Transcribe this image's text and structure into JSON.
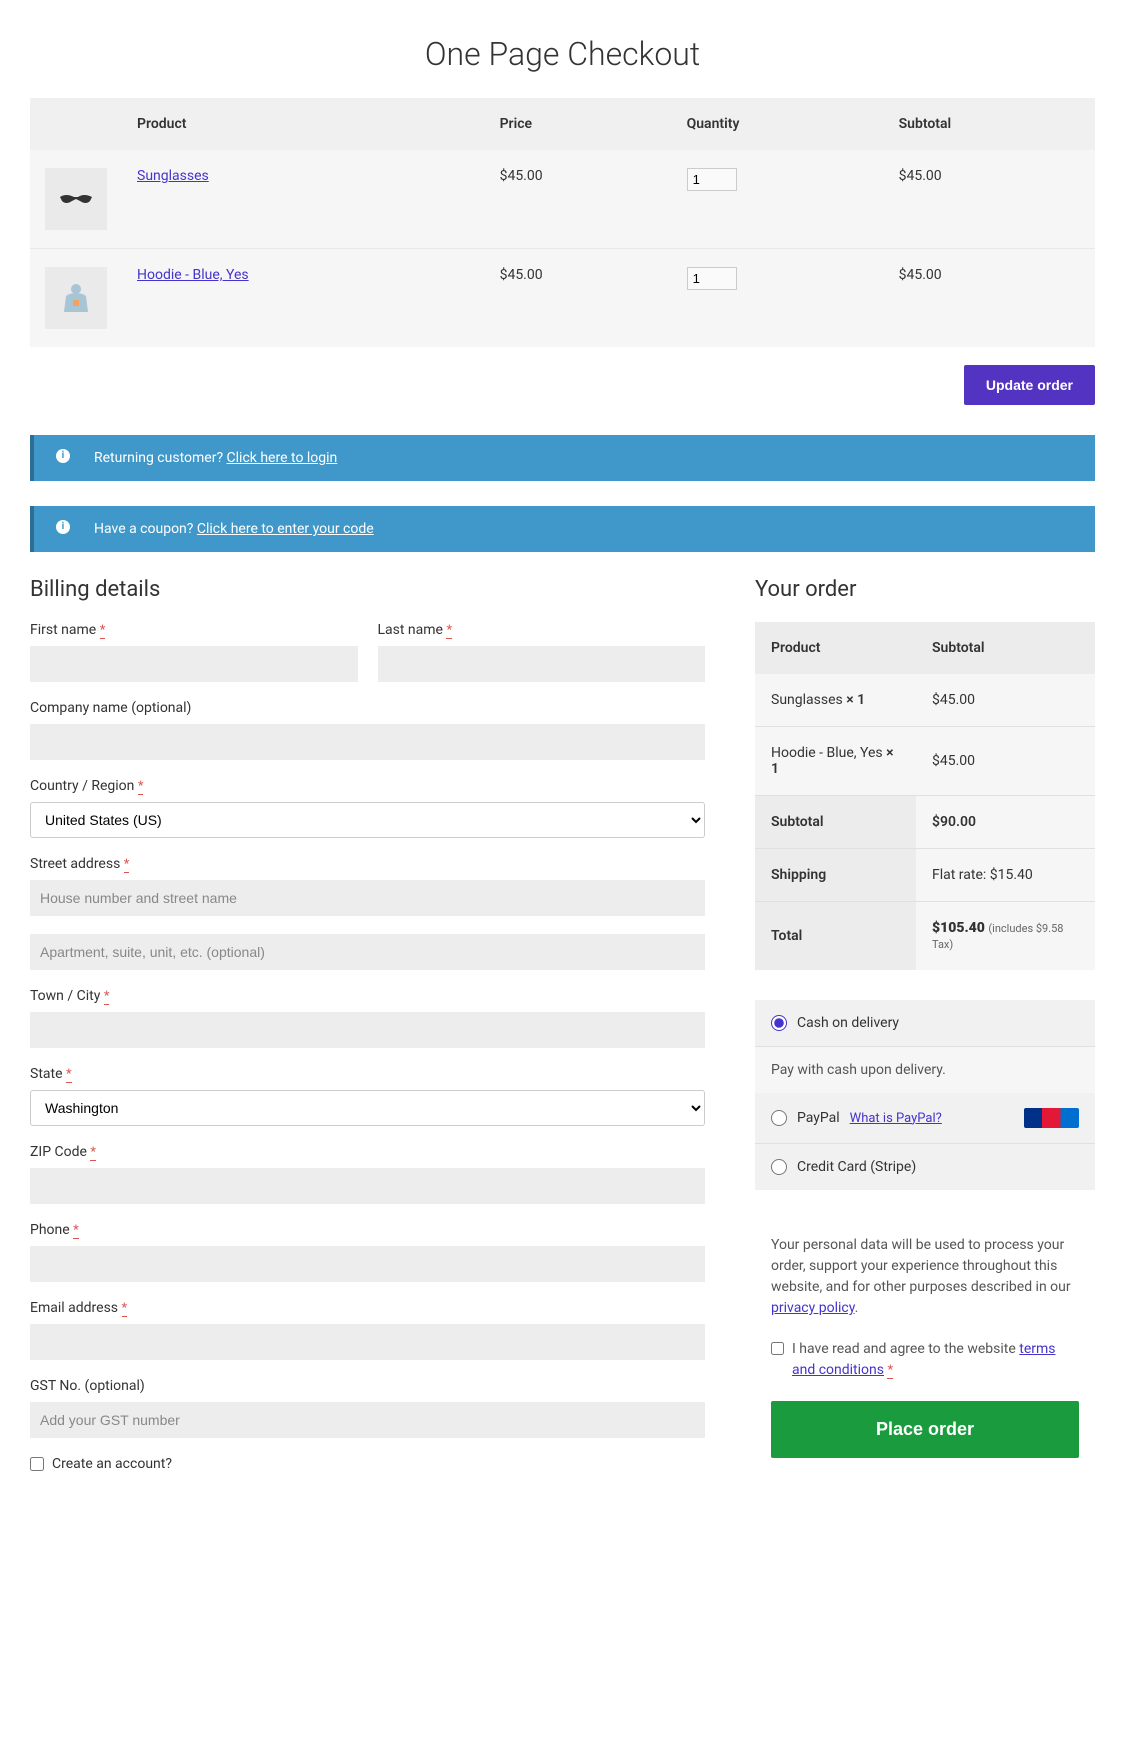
{
  "page_title": "One Page Checkout",
  "product_table": {
    "headers": {
      "product": "Product",
      "price": "Price",
      "quantity": "Quantity",
      "subtotal": "Subtotal"
    },
    "rows": [
      {
        "name": "Sunglasses",
        "price": "$45.00",
        "qty": "1",
        "subtotal": "$45.00",
        "thumb": "sunglasses"
      },
      {
        "name": "Hoodie - Blue, Yes",
        "price": "$45.00",
        "qty": "1",
        "subtotal": "$45.00",
        "thumb": "hoodie"
      }
    ]
  },
  "update_btn": "Update order",
  "notice_login": {
    "text": "Returning customer? ",
    "link": "Click here to login"
  },
  "notice_coupon": {
    "text": "Have a coupon? ",
    "link": "Click here to enter your code"
  },
  "billing": {
    "heading": "Billing details",
    "first_name": "First name",
    "last_name": "Last name",
    "company": "Company name (optional)",
    "country": "Country / Region",
    "country_selected": "United States (US)",
    "address": "Street address",
    "address_ph1": "House number and street name",
    "address_ph2": "Apartment, suite, unit, etc. (optional)",
    "city": "Town / City",
    "state": "State",
    "state_selected": "Washington",
    "zip": "ZIP Code",
    "phone": "Phone",
    "email": "Email address",
    "gst": "GST No. (optional)",
    "gst_ph": "Add your GST number",
    "create_account": "Create an account?"
  },
  "order": {
    "heading": "Your order",
    "product_col": "Product",
    "subtotal_col": "Subtotal",
    "items": [
      {
        "name": "Sunglasses ",
        "qty": " × 1",
        "subtotal": "$45.00"
      },
      {
        "name": "Hoodie - Blue, Yes ",
        "qty": " × 1",
        "subtotal": "$45.00"
      }
    ],
    "subtotal_label": "Subtotal",
    "subtotal": "$90.00",
    "shipping_label": "Shipping",
    "shipping": "Flat rate: $15.40",
    "total_label": "Total",
    "total": "$105.40",
    "tax_note": "(includes $9.58 Tax)"
  },
  "payments": {
    "cod": "Cash on delivery",
    "cod_desc": "Pay with cash upon delivery.",
    "paypal": "PayPal",
    "paypal_link": "What is PayPal?",
    "stripe": "Credit Card (Stripe)"
  },
  "privacy": {
    "text": "Your personal data will be used to process your order, support your experience throughout this website, and for other purposes described in our ",
    "link": "privacy policy",
    "terms_prefix": "I have read and agree to the website ",
    "terms_link": "terms and conditions",
    "place_order": "Place order"
  }
}
